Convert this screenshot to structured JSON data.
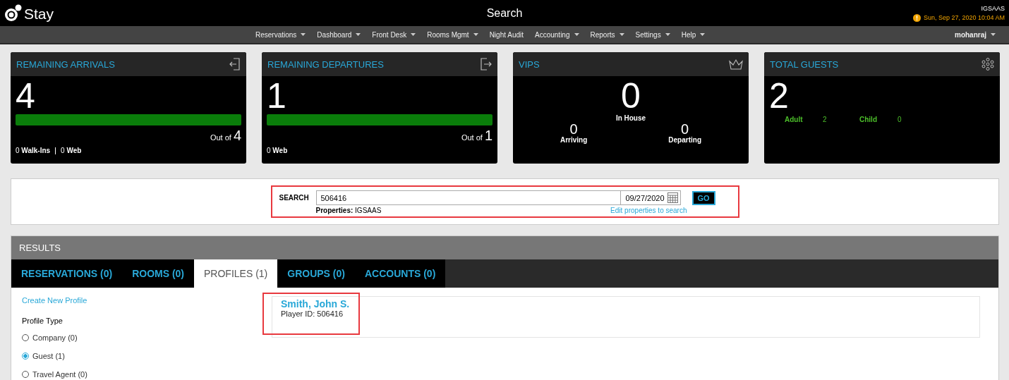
{
  "header": {
    "logo_text": "Stay",
    "title": "Search",
    "property": "IGSAAS",
    "datetime": "Sun, Sep 27, 2020 10:04 AM",
    "user": "mohanraj"
  },
  "nav": [
    {
      "label": "Reservations",
      "dropdown": true
    },
    {
      "label": "Dashboard",
      "dropdown": true
    },
    {
      "label": "Front Desk",
      "dropdown": true
    },
    {
      "label": "Rooms Mgmt",
      "dropdown": true
    },
    {
      "label": "Night Audit",
      "dropdown": false
    },
    {
      "label": "Accounting",
      "dropdown": true
    },
    {
      "label": "Reports",
      "dropdown": true
    },
    {
      "label": "Settings",
      "dropdown": true
    },
    {
      "label": "Help",
      "dropdown": true
    }
  ],
  "cards": [
    {
      "kind": "progress",
      "title": "REMAINING ARRIVALS",
      "count": "4",
      "level": 1,
      "out_of_label": "Out of",
      "out_of": "4",
      "breakdown": [
        "0 **Walk-Ins**",
        "0 **Web**"
      ]
    },
    {
      "kind": "progress",
      "title": "REMAINING DEPARTURES",
      "count": "1",
      "level": 1,
      "out_of_label": "Out of",
      "out_of": "1",
      "breakdown": [
        "0 **Web**"
      ]
    },
    {
      "kind": "vips",
      "title": "VIPS",
      "in_house": "0",
      "in_house_label": "In House",
      "arriving": "0",
      "arriving_label": "Arriving",
      "departing": "0",
      "departing_label": "Departing"
    },
    {
      "kind": "guests",
      "title": "TOTAL GUESTS",
      "count": "2",
      "stats": [
        {
          "label": "Adult",
          "value": "2"
        },
        {
          "label": "Child",
          "value": "0"
        }
      ]
    }
  ],
  "search": {
    "label": "SEARCH",
    "value": "506416",
    "date": "09/27/2020",
    "button": "GO",
    "properties_label": "Properties:",
    "properties": "IGSAAS",
    "edit_link": "Edit properties to search",
    "highlighted": true
  },
  "results": {
    "title": "RESULTS",
    "tabs": [
      {
        "label": "RESERVATIONS (0)",
        "selected": false
      },
      {
        "label": "ROOMS (0)",
        "selected": false
      },
      {
        "label": "PROFILES (1)",
        "selected": true
      },
      {
        "label": "GROUPS (0)",
        "selected": false
      },
      {
        "label": "ACCOUNTS (0)",
        "selected": false
      }
    ],
    "create_link": "Create New Profile",
    "filter_title": "Profile Type",
    "filters": [
      {
        "label": "Company (0)",
        "selected": false
      },
      {
        "label": "Guest (1)",
        "selected": true
      },
      {
        "label": "Travel Agent (0)",
        "selected": false
      }
    ],
    "profiles": [
      {
        "name": "Smith, John S.",
        "detail": "Player ID: 506416",
        "highlighted": true
      }
    ]
  }
}
